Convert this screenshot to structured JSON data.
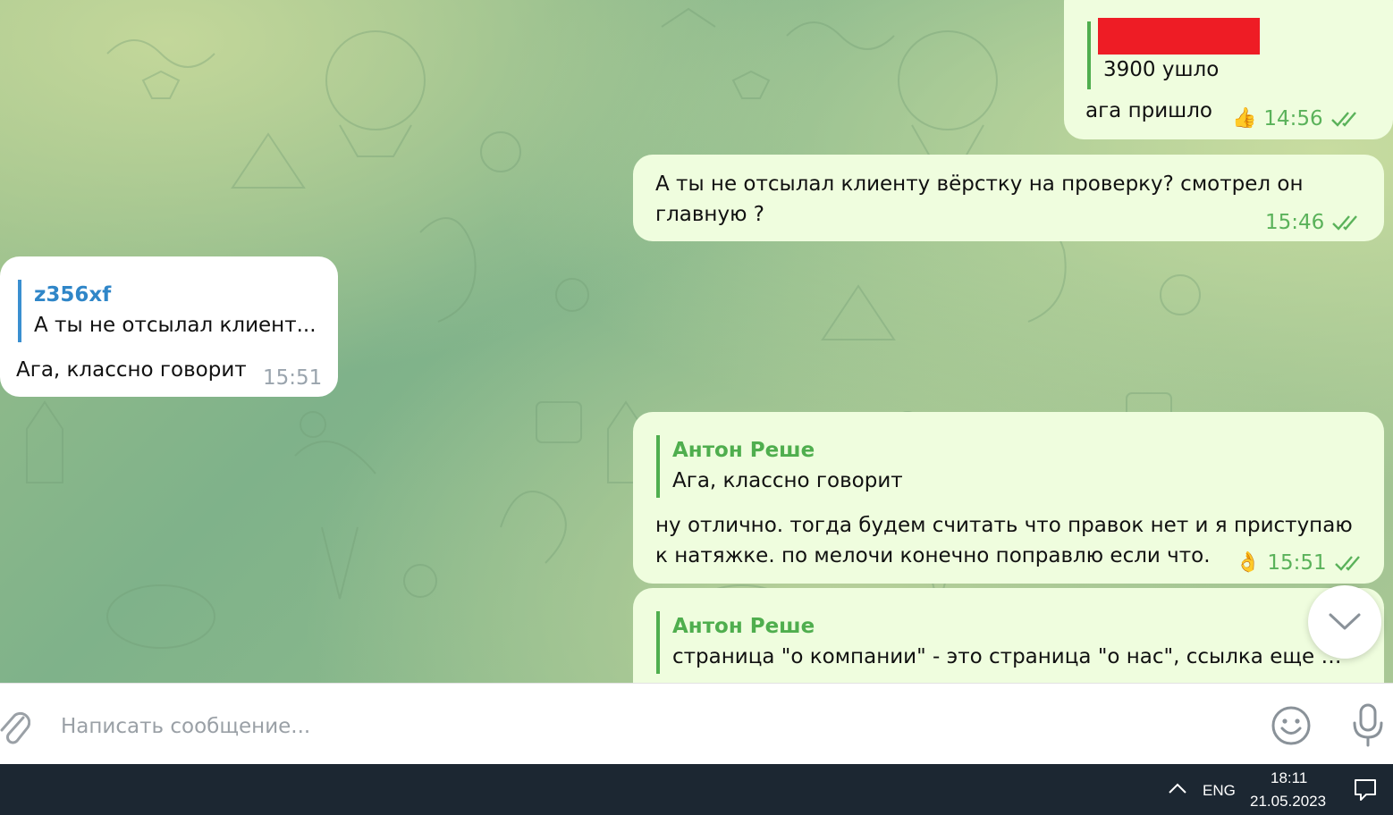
{
  "messages": [
    {
      "direction": "outgoing",
      "reply_text": "3900 ушло",
      "text": "ага пришло",
      "reaction": "👍",
      "time": "14:56",
      "read": true
    },
    {
      "direction": "outgoing",
      "text": "А ты не отсылал клиенту вёрстку на проверку? смотрел он главную ?",
      "time": "15:46",
      "read": true
    },
    {
      "direction": "incoming",
      "reply_name": "z356xf",
      "reply_text": "А ты не отсылал клиент...",
      "text": "Ага, классно говорит",
      "time": "15:51"
    },
    {
      "direction": "outgoing",
      "reply_name": "Антон Реше",
      "reply_text": "Ага, классно говорит",
      "text": "ну отлично. тогда будем считать что правок нет и я приступаю к натяжке. по мелочи конечно поправлю если что.",
      "reaction": "👌",
      "time": "15:51",
      "read": true
    },
    {
      "direction": "outgoing",
      "reply_name": "Антон Реше",
      "reply_text": "страница \"о компании\" - это страница \"о нас\", ссылка еще ес..."
    }
  ],
  "composer": {
    "placeholder": "Написать сообщение..."
  },
  "icons": {
    "attach": "paperclip-icon",
    "emoji": "smiley-icon",
    "voice": "microphone-icon",
    "scroll_down": "chevron-down-icon",
    "tray_expand": "chevron-up-icon",
    "notifications": "notification-icon"
  },
  "taskbar": {
    "language": "ENG",
    "time": "18:11",
    "date": "21.05.2023"
  },
  "colors": {
    "outgoing_bubble": "#effdde",
    "incoming_bubble": "#ffffff",
    "accent_green": "#4fae4e",
    "accent_blue": "#2f86c8",
    "redaction": "#ee1c25",
    "taskbar": "#1c2732"
  }
}
